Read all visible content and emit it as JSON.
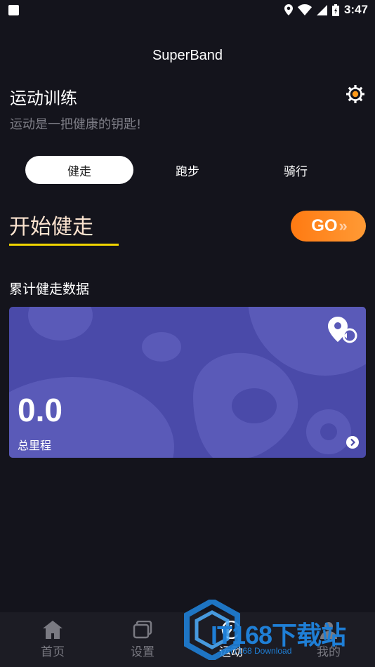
{
  "status_bar": {
    "time": "3:47"
  },
  "app": {
    "title": "SuperBand"
  },
  "header": {
    "title": "运动训练",
    "subtitle": "运动是一把健康的钥匙!"
  },
  "tabs": [
    {
      "label": "健走",
      "active": true
    },
    {
      "label": "跑步",
      "active": false
    },
    {
      "label": "骑行",
      "active": false
    }
  ],
  "start": {
    "label": "开始健走",
    "go_label": "GO",
    "go_arrows": "»"
  },
  "stats": {
    "section_label": "累计健走数据",
    "value": "0.0",
    "unit_label": "总里程"
  },
  "bottom_nav": [
    {
      "label": "首页",
      "icon": "home-icon"
    },
    {
      "label": "设置",
      "icon": "devices-icon"
    },
    {
      "label": "运动",
      "icon": "sport-icon",
      "active": true
    },
    {
      "label": "我的",
      "icon": "user-icon"
    }
  ],
  "watermark": {
    "brand": "IT168下载站",
    "sub": "IT168 Download"
  },
  "colors": {
    "background": "#14141c",
    "accent_orange": "#ff8a20",
    "underline_yellow": "#f0d500",
    "card_purple": "#4a4aa9",
    "start_text": "#fbe3cf"
  }
}
